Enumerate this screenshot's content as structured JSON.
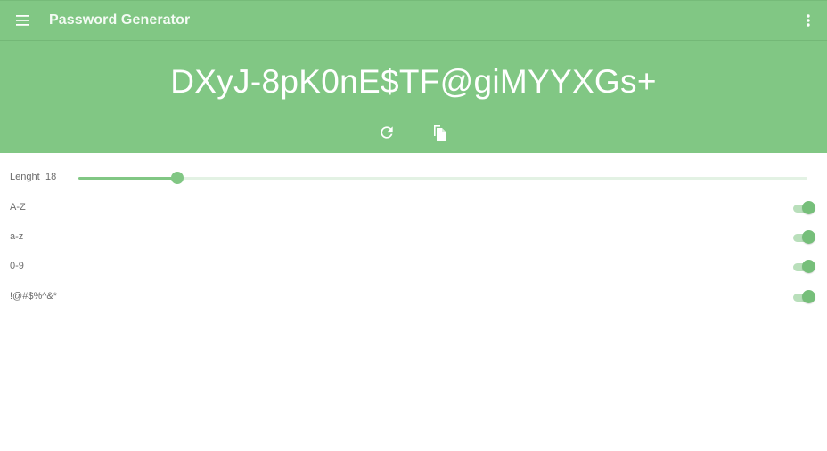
{
  "appbar": {
    "title": "Password Generator",
    "menu_icon": "hamburger-menu-icon",
    "more_icon": "more-vertical-icon"
  },
  "hero": {
    "password": "DXyJ-8pK0nE$TF@giMYYXGs+",
    "refresh_icon": "refresh-icon",
    "copy_icon": "copy-icon"
  },
  "settings": {
    "length": {
      "label": "Lenght",
      "value": "18",
      "slider_fraction": 0.136
    },
    "options": [
      {
        "label": "A-Z",
        "enabled": true
      },
      {
        "label": "a-z",
        "enabled": true
      },
      {
        "label": "0-9",
        "enabled": true
      },
      {
        "label": "!@#$%^&*",
        "enabled": true
      }
    ]
  },
  "colors": {
    "primary": "#81c784",
    "track_light": "#e3f2e4",
    "label_text": "#6b6b6b"
  }
}
